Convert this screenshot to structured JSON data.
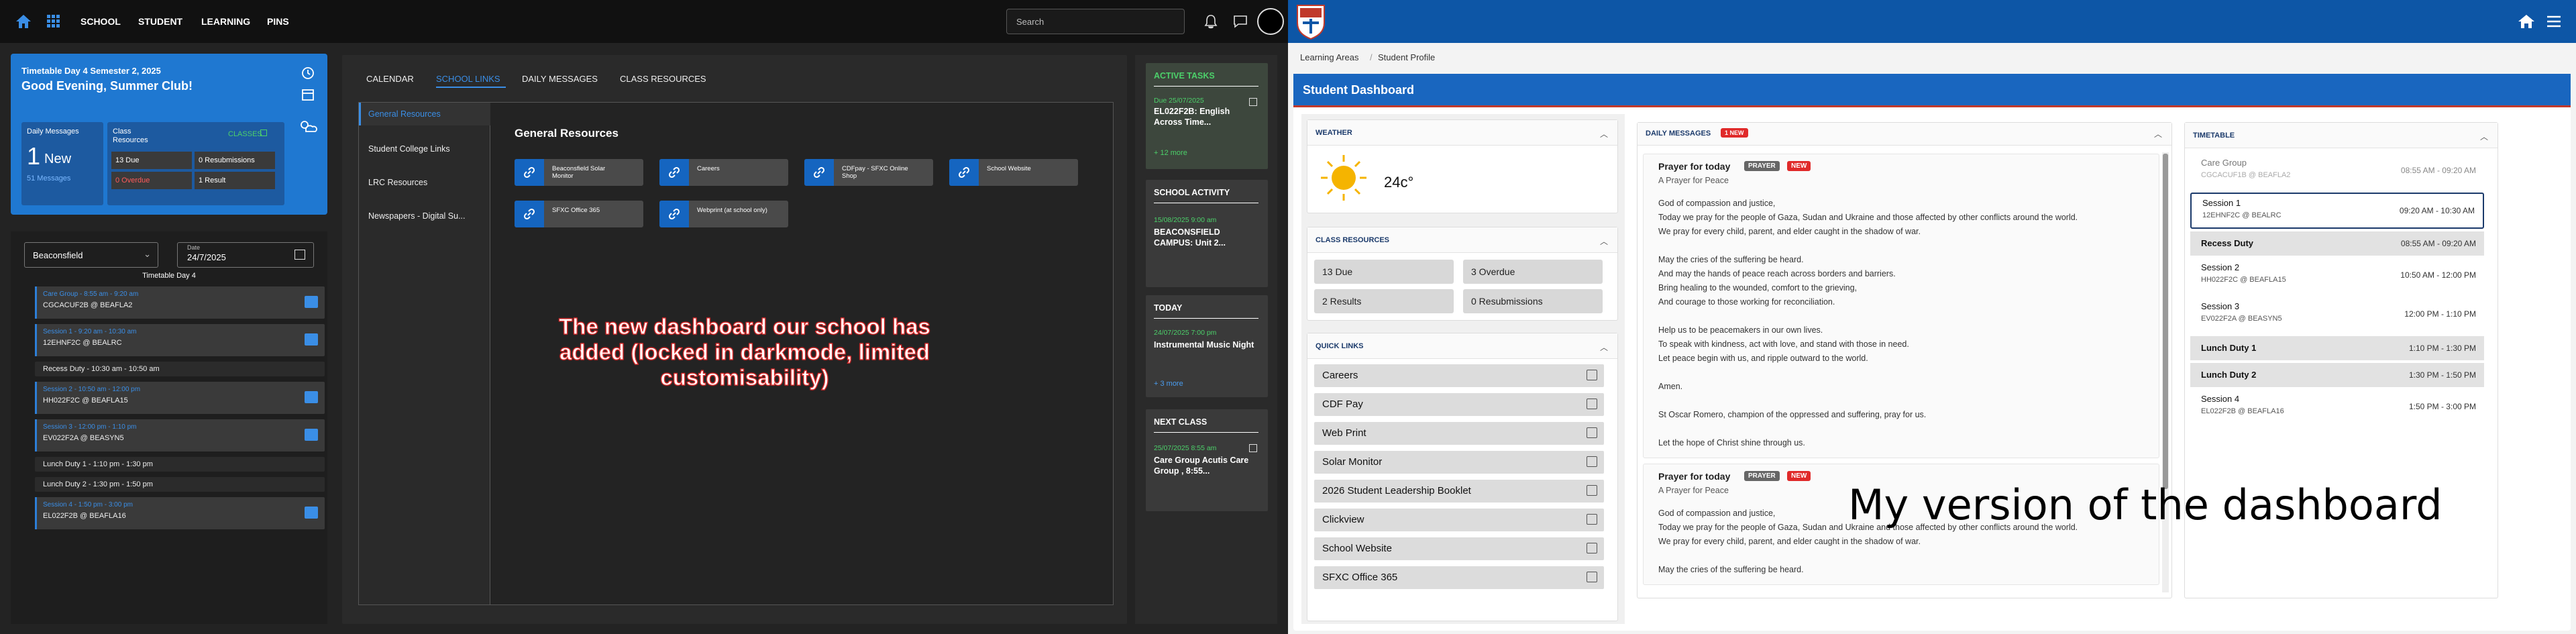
{
  "left_app": {
    "nav": [
      "SCHOOL",
      "STUDENT",
      "LEARNING",
      "PINS"
    ],
    "search_placeholder": "Search",
    "summary": {
      "date_line": "Timetable Day 4 Semester 2, 2025",
      "greeting": "Good Evening, Summer Club!",
      "daily_messages_label": "Daily Messages",
      "new_count": "1",
      "new_label": "New",
      "messages_link": "51 Messages",
      "class_resources_label": "Class Resources",
      "classes_link": "CLASSES",
      "due": "13 Due",
      "resubmissions": "0 Resubmissions",
      "overdue": "0 Overdue",
      "result": "1 Result"
    },
    "campus_select": "Beaconsfield",
    "date_label": "Date",
    "date_value": "24/7/2025",
    "timetable_day": "Timetable Day 4",
    "schedule": [
      {
        "time": "Care Group - 8:55 am - 9:20 am",
        "detail": "CGCACUF2B @ BEAFLA2",
        "kind": "class"
      },
      {
        "time": "Session 1 - 9:20 am - 10:30 am",
        "detail": "12EHNF2C @ BEALRC",
        "kind": "class"
      },
      {
        "label": "Recess Duty - 10:30 am - 10:50 am",
        "kind": "duty"
      },
      {
        "time": "Session 2 - 10:50 am - 12:00 pm",
        "detail": "HH022F2C @ BEAFLA15",
        "kind": "class"
      },
      {
        "time": "Session 3 - 12:00 pm - 1:10 pm",
        "detail": "EV022F2A @ BEASYN5",
        "kind": "class"
      },
      {
        "label": "Lunch Duty 1 - 1:10 pm - 1:30 pm",
        "kind": "duty"
      },
      {
        "label": "Lunch Duty 2 - 1:30 pm - 1:50 pm",
        "kind": "duty"
      },
      {
        "time": "Session 4 - 1:50 pm - 3:00 pm",
        "detail": "EL022F2B @ BEAFLA16",
        "kind": "class"
      }
    ],
    "tabs": [
      "CALENDAR",
      "SCHOOL LINKS",
      "DAILY MESSAGES",
      "CLASS RESOURCES"
    ],
    "subnav": [
      "General Resources",
      "Student College Links",
      "LRC Resources",
      "Newspapers - Digital Su..."
    ],
    "resources_title": "General Resources",
    "links": [
      "Beaconsfield Solar Monitor",
      "Careers",
      "CDFpay - SFXC Online Shop",
      "School Website",
      "SFXC Office 365",
      "Webprint (at school only)"
    ],
    "active_tasks": {
      "title": "ACTIVE TASKS",
      "due": "Due 25/07/2025",
      "task": "EL022F2B: English Across Time...",
      "more": "+ 12 more"
    },
    "school_activity": {
      "title": "SCHOOL ACTIVITY",
      "date": "15/08/2025 9:00 am",
      "text": "BEACONSFIELD CAMPUS: Unit 2..."
    },
    "today": {
      "title": "TODAY",
      "date": "24/07/2025 7:00 pm",
      "text": "Instrumental Music Night",
      "more": "+ 3 more"
    },
    "next_class": {
      "title": "NEXT CLASS",
      "date": "25/07/2025 8:55 am",
      "text": "Care Group Acutis Care Group , 8:55..."
    }
  },
  "annotation_left": "The new dashboard our school has added (locked in darkmode, limited customisability)",
  "right_app": {
    "breadcrumb": [
      "Learning Areas",
      "Student Profile"
    ],
    "dashboard_title": "Student Dashboard",
    "weather": {
      "title": "WEATHER",
      "temp": "24c°"
    },
    "class_resources": {
      "title": "CLASS RESOURCES",
      "due": "13 Due",
      "overdue": "3 Overdue",
      "results": "2 Results",
      "resub": "0 Resubmissions"
    },
    "quick_links": {
      "title": "QUICK LINKS",
      "items": [
        "Careers",
        "CDF Pay",
        "Web Print",
        "Solar Monitor",
        "2026 Student Leadership Booklet",
        "Clickview",
        "School Website",
        "SFXC Office 365"
      ]
    },
    "daily_messages": {
      "title": "DAILY MESSAGES",
      "new_badge": "1 NEW",
      "messages": [
        {
          "title": "Prayer for today",
          "tag": "PRAYER",
          "new": "NEW",
          "subtitle": "A Prayer for Peace",
          "lines": [
            "God of compassion and justice,",
            "Today we pray for the people of Gaza, Sudan and Ukraine and those affected by other conflicts around the world.",
            "We pray for every child, parent, and elder caught in the shadow of war.",
            "",
            "May the cries of the suffering be heard.",
            "And may the hands of peace reach across borders and barriers.",
            "Bring healing to the wounded, comfort to the grieving,",
            "And courage to those working for reconciliation.",
            "",
            "Help us to be peacemakers in our own lives.",
            "To speak with kindness, act with love, and stand with those in need.",
            "Let peace begin with us, and ripple outward to the world.",
            "",
            "Amen.",
            "",
            "St Oscar Romero, champion of the oppressed and suffering, pray for us.",
            "",
            "Let the hope of Christ shine through us."
          ]
        },
        {
          "title": "Prayer for today",
          "tag": "PRAYER",
          "new": "NEW",
          "subtitle": "A Prayer for Peace",
          "lines": [
            "God of compassion and justice,",
            "Today we pray for the people of Gaza, Sudan and Ukraine and those affected by other conflicts around the world.",
            "We pray for every child, parent, and elder caught in the shadow of war.",
            "",
            "May the cries of the suffering be heard."
          ]
        }
      ]
    },
    "timetable": {
      "title": "TIMETABLE",
      "items": [
        {
          "name": "Care Group",
          "room": "CGCACUF1B @ BEAFLA2",
          "time": "08:55 AM - 09:20 AM",
          "state": "past"
        },
        {
          "name": "Session 1",
          "room": "12EHNF2C @ BEALRC",
          "time": "09:20 AM - 10:30 AM",
          "state": "current"
        },
        {
          "name": "Recess Duty",
          "room": "",
          "time": "08:55 AM - 09:20 AM",
          "state": "duty"
        },
        {
          "name": "Session 2",
          "room": "HH022F2C @ BEAFLA15",
          "time": "10:50 AM - 12:00 PM",
          "state": "normal"
        },
        {
          "name": "Session 3",
          "room": "EV022F2A @ BEASYN5",
          "time": "12:00 PM - 1:10 PM",
          "state": "normal"
        },
        {
          "name": "Lunch Duty 1",
          "room": "",
          "time": "1:10 PM - 1:30 PM",
          "state": "duty"
        },
        {
          "name": "Lunch Duty 2",
          "room": "",
          "time": "1:30 PM - 1:50 PM",
          "state": "duty"
        },
        {
          "name": "Session 4",
          "room": "EL022F2B @ BEAFLA16",
          "time": "1:50 PM - 3:00 PM",
          "state": "normal"
        }
      ]
    }
  },
  "annotation_right": "My version of the dashboard",
  "colors": {
    "left_bg": "#232323",
    "accent_blue": "#1f78d1",
    "right_header": "#0d56a6",
    "dash_title_bg": "#1966bf",
    "red_badge": "#e02a2a"
  }
}
